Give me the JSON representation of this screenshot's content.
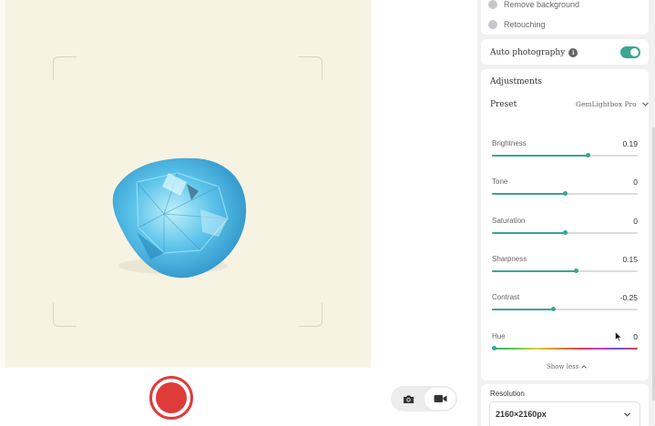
{
  "options": {
    "remove_background": "Remove background",
    "retouching": "Retouching"
  },
  "auto_photography": {
    "label": "Auto photography",
    "enabled": true,
    "info_icon": "info-icon"
  },
  "adjustments": {
    "title": "Adjustments",
    "preset_label": "Preset",
    "preset_value": "GemLightbox Pro",
    "sliders": [
      {
        "name": "Brightness",
        "value": "0.19",
        "level": 0.66
      },
      {
        "name": "Tone",
        "value": "0",
        "level": 0.5
      },
      {
        "name": "Saturation",
        "value": "0",
        "level": 0.5
      },
      {
        "name": "Sharpness",
        "value": "0.15",
        "level": 0.58
      },
      {
        "name": "Contrast",
        "value": "-0.25",
        "level": 0.42
      },
      {
        "name": "Hue",
        "value": "0",
        "level": 0.0
      }
    ],
    "show_less": "Show less"
  },
  "resolution": {
    "label": "Resolution",
    "value": "2160×2160px"
  },
  "capture": {
    "record_icon": "record-icon",
    "photo_icon": "camera-icon",
    "video_icon": "video-camera-icon",
    "selected_mode": "video"
  },
  "colors": {
    "accent": "#3aa592",
    "record": "#e03b3b",
    "preview_bg": "#f6f3e2"
  }
}
